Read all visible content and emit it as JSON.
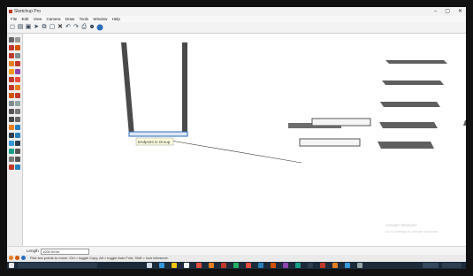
{
  "window": {
    "title": "Sketchup Pro",
    "controls": [
      "–",
      "▢",
      "✕"
    ]
  },
  "menu": {
    "items": [
      "File",
      "Edit",
      "View",
      "Camera",
      "Draw",
      "Tools",
      "Window",
      "Help"
    ]
  },
  "toolbar": {
    "icons": [
      "select-icon",
      "eraser-icon",
      "paint-icon",
      "line-icon",
      "arc-icon",
      "shape-icon",
      "push-pull-icon",
      "move-icon",
      "rotate-icon",
      "scale-icon",
      "offset-icon",
      "tape-icon"
    ]
  },
  "canvas": {
    "tooltip": "Endpoint in Group"
  },
  "status": {
    "length_label": "Length",
    "length_value": "1000.0mm",
    "hint": "Pick two points to move. Ctrl = toggle Copy, Alt = toggle Auto Fold, Shift = lock inference.",
    "watermark_line1": "Activate Windows",
    "watermark_line2": "Go to Settings to activate Windows."
  },
  "colors": {
    "accent": "#2a6ebb",
    "shelf": "#555555",
    "taskbar": "#1c2a3a"
  }
}
